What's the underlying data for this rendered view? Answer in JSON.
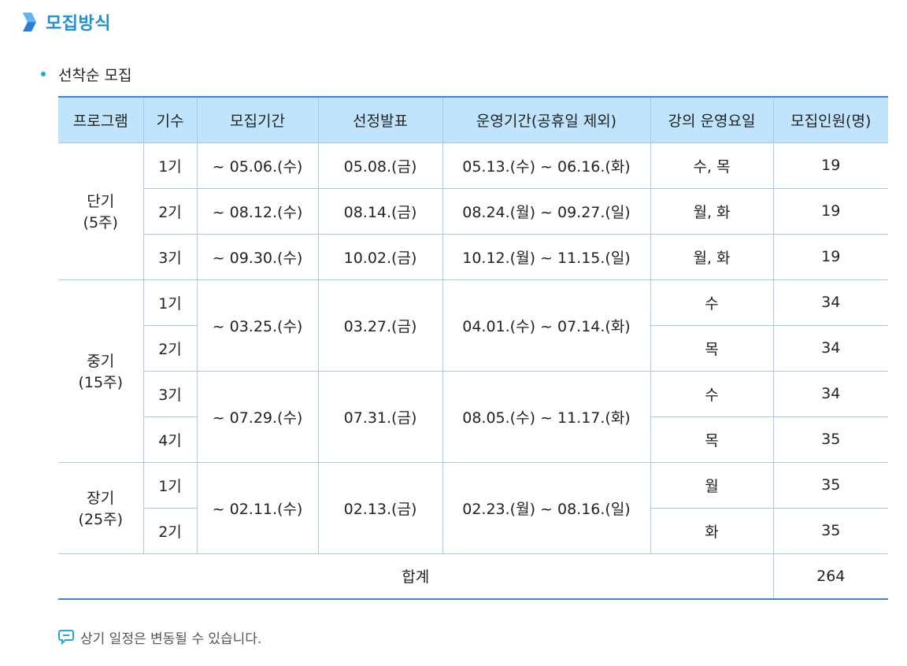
{
  "section": {
    "title": "모집방식",
    "icon": "chevron-right-icon",
    "color": "#1f8fd6"
  },
  "bullet": {
    "text": "선착순 모집"
  },
  "table": {
    "headers": [
      "프로그램",
      "기수",
      "모집기간",
      "선정발표",
      "운영기간(공휴일 제외)",
      "강의 운영요일",
      "모집인원(명)"
    ],
    "short": {
      "program": [
        "단기",
        "(5주)"
      ],
      "rows": [
        {
          "term": "1기",
          "period": "~ 05.06.(수)",
          "announce": "05.08.(금)",
          "operation": "05.13.(수) ~ 06.16.(화)",
          "days": "수, 목",
          "count": "19"
        },
        {
          "term": "2기",
          "period": "~ 08.12.(수)",
          "announce": "08.14.(금)",
          "operation": "08.24.(월) ~ 09.27.(일)",
          "days": "월, 화",
          "count": "19"
        },
        {
          "term": "3기",
          "period": "~ 09.30.(수)",
          "announce": "10.02.(금)",
          "operation": "10.12.(월) ~ 11.15.(일)",
          "days": "월, 화",
          "count": "19"
        }
      ]
    },
    "mid": {
      "program": [
        "중기",
        "(15주)"
      ],
      "groups": [
        {
          "period": "~ 03.25.(수)",
          "announce": "03.27.(금)",
          "operation": "04.01.(수) ~ 07.14.(화)",
          "rows": [
            {
              "term": "1기",
              "days": "수",
              "count": "34"
            },
            {
              "term": "2기",
              "days": "목",
              "count": "34"
            }
          ]
        },
        {
          "period": "~ 07.29.(수)",
          "announce": "07.31.(금)",
          "operation": "08.05.(수) ~ 11.17.(화)",
          "rows": [
            {
              "term": "3기",
              "days": "수",
              "count": "34"
            },
            {
              "term": "4기",
              "days": "목",
              "count": "35"
            }
          ]
        }
      ]
    },
    "long": {
      "program": [
        "장기",
        "(25주)"
      ],
      "period": "~ 02.11.(수)",
      "announce": "02.13.(금)",
      "operation": "02.23.(월) ~ 08.16.(일)",
      "rows": [
        {
          "term": "1기",
          "days": "월",
          "count": "35"
        },
        {
          "term": "2기",
          "days": "화",
          "count": "35"
        }
      ]
    },
    "total": {
      "label": "합계",
      "value": "264"
    },
    "colors": {
      "header_bg": "#bfe4fb",
      "border": "#a9c7e6",
      "rule": "#3b82d8"
    }
  },
  "note": {
    "icon": "speech-bubble-icon",
    "text": "상기 일정은 변동될 수 있습니다."
  }
}
